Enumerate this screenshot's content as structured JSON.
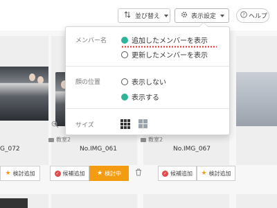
{
  "toolbar": {
    "sort_label": "並び替え",
    "settings_label": "表示設定",
    "help_label": "ヘルプ"
  },
  "cards": [
    {
      "room": "",
      "name": "G_072",
      "candidate_label": "",
      "review_label": "検討追加"
    },
    {
      "room": "教室2",
      "name": "No.IMG_061",
      "candidate_label": "候補追加",
      "review_label": "検討中"
    },
    {
      "room": "教室2",
      "name": "No.IMG_067",
      "candidate_label": "候補追加",
      "review_label": "検討追加"
    }
  ],
  "dropdown": {
    "member_name": {
      "label": "メンバー名",
      "options": [
        "追加したメンバーを表示",
        "更新したメンバーを表示"
      ],
      "selected": 0
    },
    "face_position": {
      "label": "顔の位置",
      "options": [
        "表示しない",
        "表示する"
      ],
      "selected": 1
    },
    "size": {
      "label": "サイズ",
      "options": [
        "grid-3x3-icon",
        "grid-2x2-icon"
      ],
      "selected": 0
    }
  },
  "colors": {
    "accent_teal": "#2fb39a",
    "orange": "#f39c12",
    "red": "#e14b4b"
  }
}
